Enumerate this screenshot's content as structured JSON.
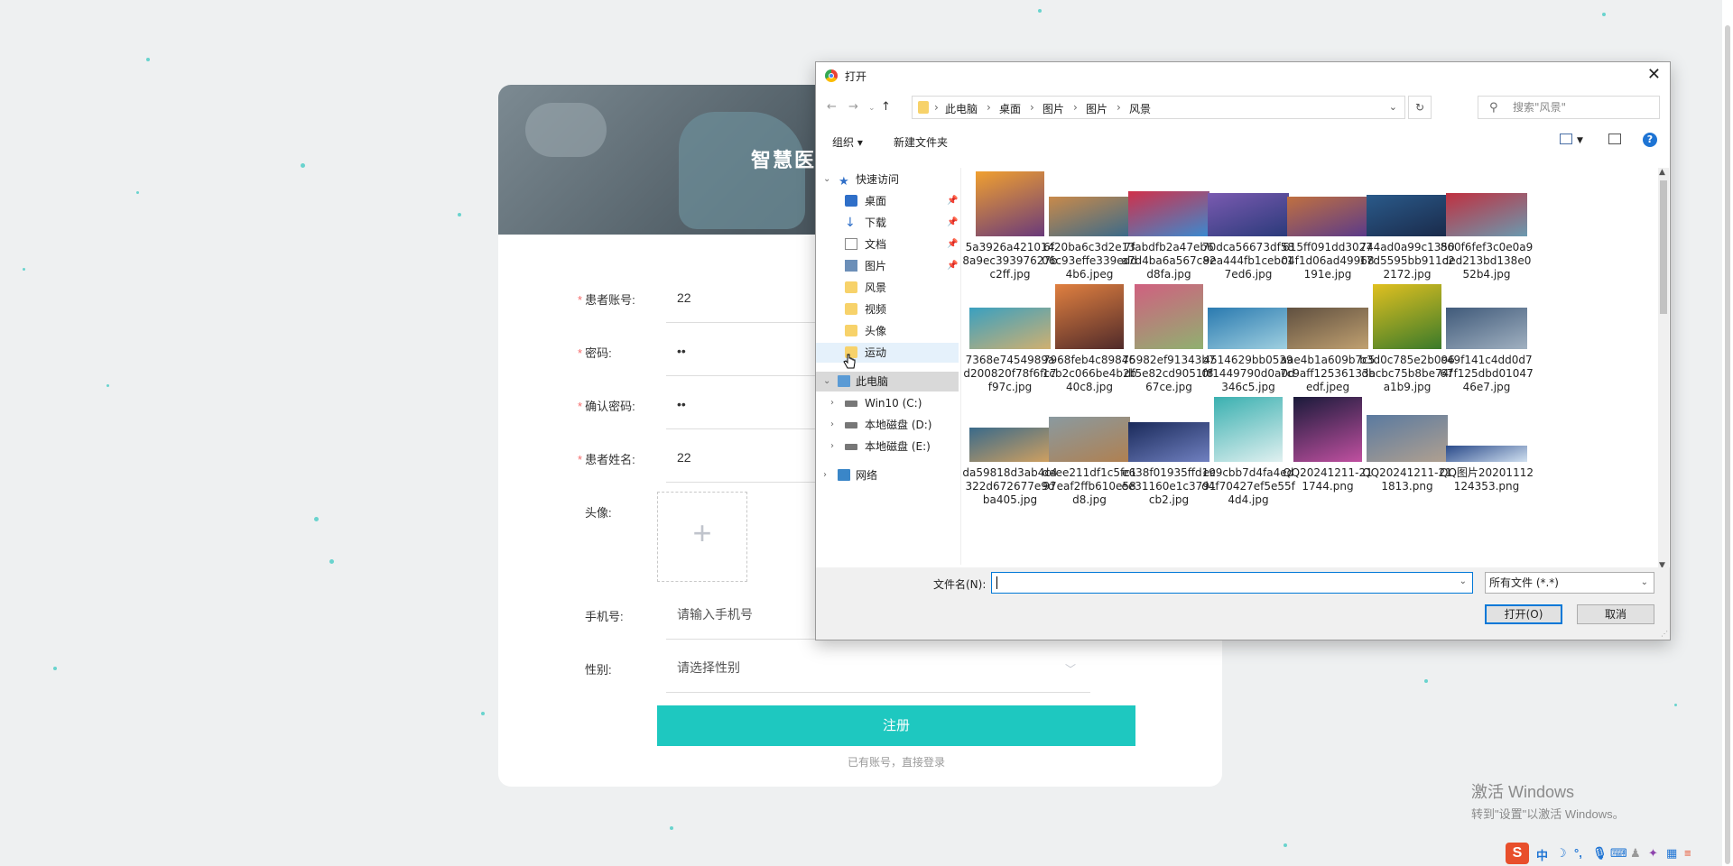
{
  "page": {
    "banner_title": "智慧医",
    "form": [
      {
        "label": "患者账号:",
        "required": true,
        "value": "22"
      },
      {
        "label": "密码:",
        "required": true,
        "value": "••"
      },
      {
        "label": "确认密码:",
        "required": true,
        "value": "••"
      },
      {
        "label": "患者姓名:",
        "required": true,
        "value": "22"
      }
    ],
    "avatar_label": "头像:",
    "avatar_plus": "+",
    "phone_label": "手机号:",
    "phone_placeholder": "请输入手机号",
    "gender_label": "性别:",
    "gender_placeholder": "请选择性别",
    "submit_label": "注册",
    "login_link": "已有账号，直接登录",
    "required_mark": "*"
  },
  "dialog": {
    "title": "打开",
    "close": "✕",
    "breadcrumb": [
      "此电脑",
      "桌面",
      "图片",
      "图片",
      "风景"
    ],
    "search_placeholder": "搜索\"风景\"",
    "toolbar": {
      "organize": "组织 ▾",
      "new_folder": "新建文件夹",
      "help": "?"
    },
    "nav": {
      "quick_access": "快速访问",
      "quick_items": [
        {
          "label": "桌面",
          "icon": "desktop-icon",
          "pinned": true
        },
        {
          "label": "下载",
          "icon": "download-icon",
          "pinned": true
        },
        {
          "label": "文档",
          "icon": "document-icon",
          "pinned": true
        },
        {
          "label": "图片",
          "icon": "pictures-icon",
          "pinned": true
        },
        {
          "label": "风景",
          "icon": "folder-icon",
          "pinned": false
        },
        {
          "label": "视频",
          "icon": "folder-icon",
          "pinned": false
        },
        {
          "label": "头像",
          "icon": "folder-icon",
          "pinned": false
        },
        {
          "label": "运动",
          "icon": "folder-icon",
          "pinned": false
        }
      ],
      "this_pc": "此电脑",
      "drives": [
        "Win10 (C:)",
        "本地磁盘 (D:)",
        "本地磁盘 (E:)"
      ],
      "network": "网络"
    },
    "files": [
      "5a3926a4210148a9ec393976​27bc2ff.jpg",
      "6f20ba6c3d2e1306c93effe339edd4b6.jpeg",
      "7fabdfb2a47eb6a7d4ba6a567c82d8fa.jpg",
      "70dca56673df589ea444fb1cebc17ed6.jpg",
      "615ff091dd302704f1d06ad49968191e.jpg",
      "744ad0a99c135017d5595bb911c22172.jpg",
      "860f6fef3c0e0a9ded213bd138e052b4.jpg",
      "7368e7454989ad200820f78f6fc7f97c.jpg",
      "7968feb4c898461cb2c066be4b2b40c8.jpg",
      "75982ef91343b7df5e82cd9051f867ce.jpg",
      "4514629bb05390f1449790d0a0d346c5.jpg",
      "aae4b1a609b7c57c9aff12536133aedf.jpeg",
      "b3d0c785e2b096dbcbc75b8be74fa1b9.jpg",
      "c49f141c4dd0d767f125dbd0104746e7.jpg",
      "da59818d3ab4c4322d672677e9dba405.jpg",
      "deee211df1c5fc197eaf2ffb610e58d8.jpg",
      "e638f01935ffd19ee31160e1c3791cb2.jpg",
      "ec9cbb7d4fa4edd4f70427ef5e55f4d4.jpg",
      "QQ20241211-211744.png",
      "QQ20241211-211813.png",
      "QQ图片20201112124353.png"
    ],
    "filename_label": "文件名(N):",
    "filename_value": "",
    "filetype": "所有文件 (*.*)",
    "open_button": "打开(O)",
    "cancel_button": "取消"
  },
  "watermark": {
    "line1": "激活 Windows",
    "line2": "转到\"设置\"以激活 Windows。"
  },
  "tray": {
    "ime_logo": "S",
    "ime_mode": "中"
  },
  "colors": {
    "accent": "#1ec8c0",
    "required": "#f56c6c",
    "dialog_primary": "#0078d7"
  }
}
